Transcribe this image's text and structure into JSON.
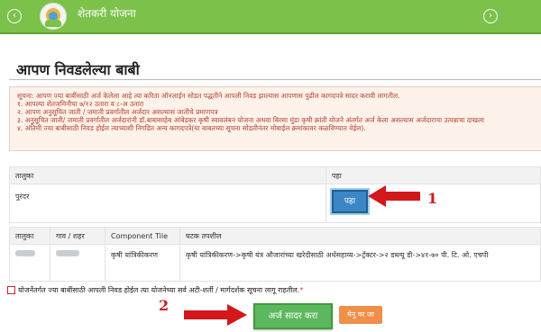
{
  "header": {
    "app_title": "शेतकरी योजना",
    "left_nav_icon": "chevron-left-circle-icon",
    "right_nav_icon": "chevron-right-circle-icon",
    "accent_color": "#7cc24a"
  },
  "page": {
    "heading": "आपण निवडलेल्या बाबी"
  },
  "notice": {
    "color": "#b04032",
    "lines": [
      "सूचना: आपण ज्या बाबींसाठी अर्ज केलेला आहे त्या करिता ऑनलाईन सोडत पद्धतीने आपली निवड झाल्यास आपणास पुढील कागदपत्रे सादर करावी लागतील.",
      "१. आपल्या शेतजमिनीचा ७/१२ उतारा व ८-अ उतारा",
      "२. आपण अनुसूचित जाती / जमाती प्रवर्गातील अर्जदार असल्यास जातीचे प्रमाणपत्र",
      "३. अनुसूचित जाती/ जमाती प्रवर्गातील अर्जदारांनी डॉ.बाबासाहेब आंबेडकर कृषी स्वावलंबन योजना अथवा बिरसा मुंडा कृषी क्रांती योजने अंतर्गत अर्ज केला असल्यास अर्जदाराचा उत्पन्नाचा दाखला",
      "४. अंतिमी ज्या बाबीसाठी निवड होईल त्याच्याशी निगडित अन्य कागदपत्रे(या बाबतच्या सूचना सोडतीनंतर मोबाईल क्रमांकावर कळविण्यात येईल)."
    ]
  },
  "location_table": {
    "headers": [
      "तालुका",
      "पहा"
    ],
    "row": {
      "taluka": "पुरंदर",
      "view_button": "पहा"
    }
  },
  "components_table": {
    "headers": [
      "तालुका",
      "गाव / शहर",
      "Component Tile",
      "घटक तपशील"
    ],
    "row": {
      "component": "कृषी यांत्रिकीकरण",
      "details": "कृषी यांत्रिकीकरण->कृषी यंत्र औजारांच्या खरेदीसाठी अर्थसहाय्य->ट्रॅक्टर->२ डब्ल्यू डी->४१-७० पी. टि. ओ. एचपी"
    }
  },
  "agreement": {
    "text": "योजनेंतर्गत ज्या बाबींसाठी आपली निवड होईल त्या योजनेच्या सर्व अटी-शर्ती / मार्गदर्शक सूचना लागू राहतील.",
    "required_mark": "*"
  },
  "actions": {
    "submit_label": "अर्ज सादर करा",
    "menu_label": "मेनू वर जा"
  },
  "annotations": {
    "marker1": "1",
    "marker2": "2",
    "color": "#d3171b"
  }
}
